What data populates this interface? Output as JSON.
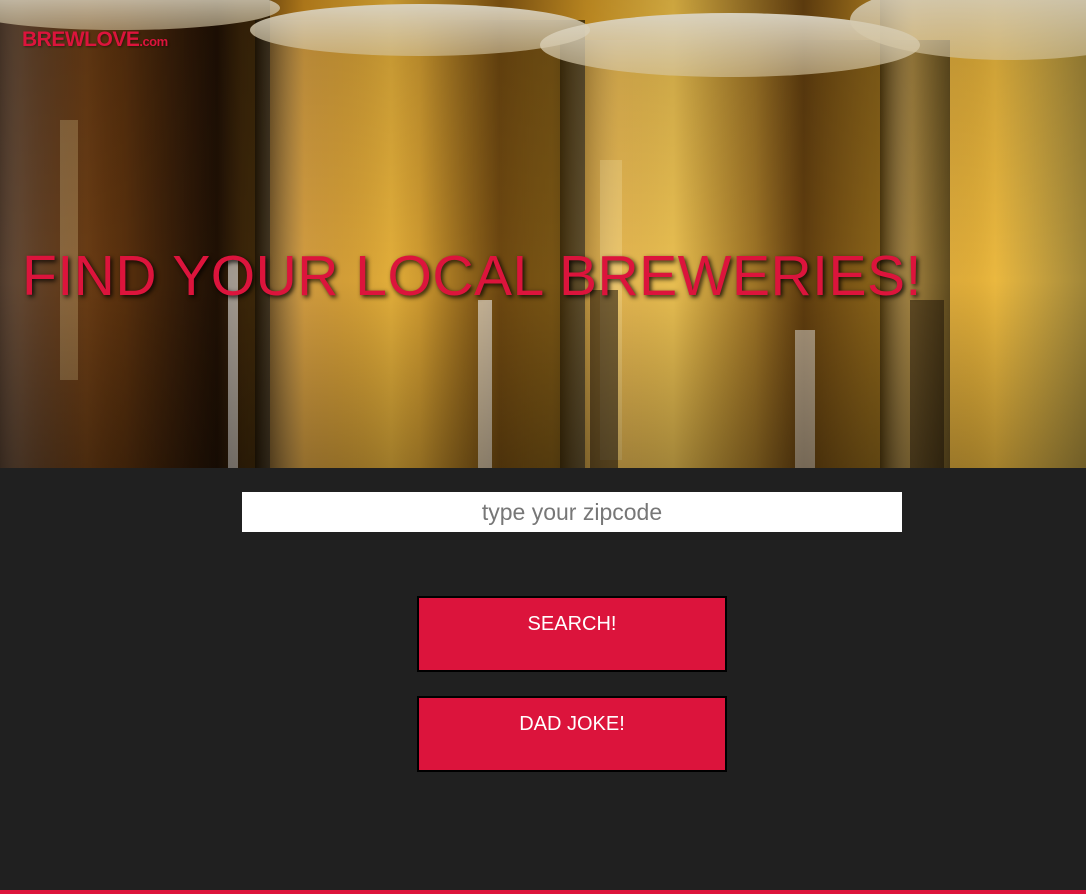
{
  "brand": {
    "name": "BREWLOVE",
    "suffix": ".com",
    "color": "#dc143c"
  },
  "hero": {
    "headline": "FIND YOUR LOCAL BREWERIES!",
    "background": "beer-glasses-photo"
  },
  "search": {
    "placeholder": "type your zipcode",
    "value": ""
  },
  "buttons": {
    "search_label": "SEARCH!",
    "joke_label": "DAD JOKE!"
  },
  "colors": {
    "accent": "#dc143c",
    "page_background": "#202020"
  }
}
